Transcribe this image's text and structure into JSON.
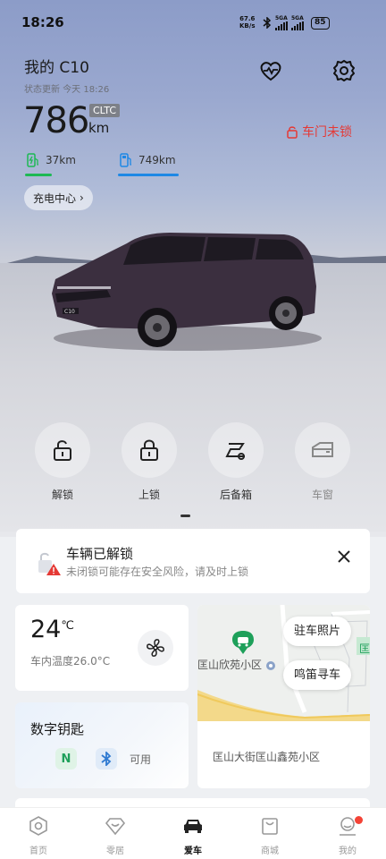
{
  "status_bar": {
    "time": "18:26",
    "net_speed_value": "67.6",
    "net_speed_unit": "KB/s",
    "sim1": "5GA",
    "sim2": "5GA",
    "battery": "85"
  },
  "vehicle": {
    "name": "我的 C10",
    "update_status": "状态更新 今天 18:26",
    "range": "786",
    "range_standard": "CLTC",
    "range_unit": "km",
    "door_status": "车门未锁",
    "electric_range": "37km",
    "fuel_range": "749km",
    "electric_fraction": 0.05,
    "fuel_fraction": 0.95,
    "plate": "C10"
  },
  "charge_center_label": "充电中心",
  "controls": [
    {
      "label": "解锁",
      "icon": "unlock-icon"
    },
    {
      "label": "上锁",
      "icon": "lock-icon"
    },
    {
      "label": "后备箱",
      "icon": "trunk-icon"
    },
    {
      "label": "车窗",
      "icon": "window-icon"
    }
  ],
  "alert": {
    "title": "车辆已解锁",
    "message": "未闭锁可能存在安全风险，请及时上锁"
  },
  "climate": {
    "temperature": "24",
    "temp_unit": "℃",
    "inside_temp": "车内温度26.0°C"
  },
  "digital_key": {
    "title": "数字钥匙",
    "nfc_label": "N",
    "status": "可用"
  },
  "map": {
    "poi_label": "匡山欣苑小区",
    "parking_photo": "驻车照片",
    "honk_find": "鸣笛寻车",
    "address": "匡山大街匡山鑫苑小区",
    "edge_glyph": "匡"
  },
  "tabs": [
    {
      "label": "首页",
      "icon": "home-icon"
    },
    {
      "label": "零居",
      "icon": "heart-diamond-icon"
    },
    {
      "label": "爱车",
      "icon": "car-icon"
    },
    {
      "label": "商城",
      "icon": "shopping-bag-icon"
    },
    {
      "label": "我的",
      "icon": "profile-icon"
    }
  ],
  "active_tab": "爱车",
  "colors": {
    "accent_green": "#1db954",
    "accent_blue": "#1e88e5",
    "warning_red": "#e53935"
  }
}
